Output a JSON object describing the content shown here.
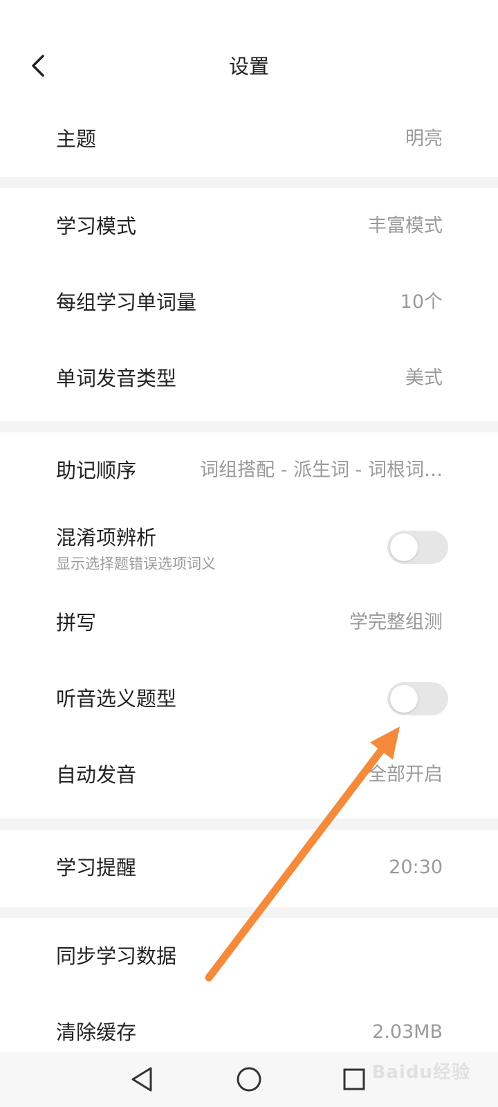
{
  "header": {
    "title": "设置"
  },
  "groups": {
    "theme": {
      "label": "主题",
      "value": "明亮"
    },
    "study_mode": {
      "label": "学习模式",
      "value": "丰富模式"
    },
    "words_per_group": {
      "label": "每组学习单词量",
      "value": "10个"
    },
    "pronunciation": {
      "label": "单词发音类型",
      "value": "美式"
    },
    "mnemonic_order": {
      "label": "助记顺序",
      "value": "词组搭配 - 派生词 - 词根词…"
    },
    "confusion": {
      "label": "混淆项辨析",
      "sublabel": "显示选择题错误选项词义",
      "enabled": false
    },
    "spelling": {
      "label": "拼写",
      "value": "学完整组测"
    },
    "listening": {
      "label": "听音选义题型",
      "enabled": false
    },
    "auto_pronounce": {
      "label": "自动发音",
      "value": "全部开启"
    },
    "reminder": {
      "label": "学习提醒",
      "value": "20:30"
    },
    "sync": {
      "label": "同步学习数据"
    },
    "cache": {
      "label": "清除缓存",
      "value": "2.03MB"
    }
  },
  "navbar": {
    "icons": [
      "back-triangle-icon",
      "home-circle-icon",
      "recents-square-icon"
    ]
  },
  "watermark": {
    "text": "Baidu经验"
  },
  "colors": {
    "arrow": "#f58a3a",
    "toggle_off": "#e6e6e6",
    "divider": "#f4f4f4"
  }
}
